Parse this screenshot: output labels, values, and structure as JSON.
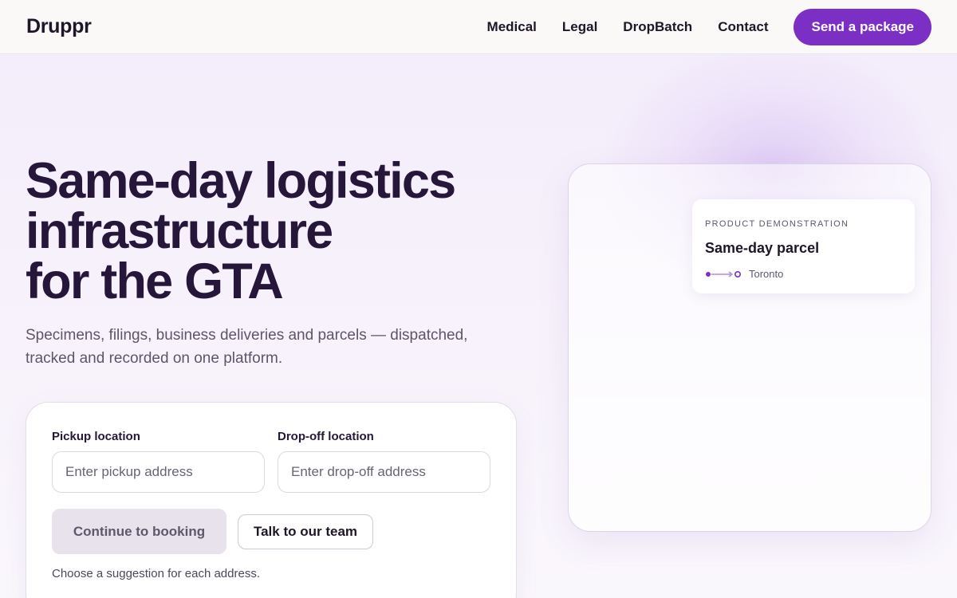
{
  "header": {
    "logo": "Druppr",
    "nav": [
      {
        "label": "Medical"
      },
      {
        "label": "Legal"
      },
      {
        "label": "DropBatch"
      },
      {
        "label": "Contact"
      }
    ],
    "cta_label": "Send a package"
  },
  "hero": {
    "title_lines": [
      "Same-day logistics",
      "infrastructure",
      "for the GTA"
    ],
    "subtitle": "Specimens, filings, business deliveries and parcels — dispatched, tracked and recorded on one platform."
  },
  "booking": {
    "pickup_label": "Pickup location",
    "pickup_placeholder": "Enter pickup address",
    "pickup_value": "",
    "dropoff_label": "Drop-off location",
    "dropoff_placeholder": "Enter drop-off address",
    "dropoff_value": "",
    "continue_label": "Continue to booking",
    "talk_label": "Talk to our team",
    "hint": "Choose a suggestion for each address."
  },
  "demo": {
    "eyebrow": "PRODUCT DEMONSTRATION",
    "title": "Same-day parcel",
    "route_city": "Toronto",
    "route_icon": "route-arrow-icon"
  },
  "colors": {
    "brand": "#7b2fc4",
    "heading": "#25163a",
    "button_disabled_bg": "#e7e2ec"
  }
}
